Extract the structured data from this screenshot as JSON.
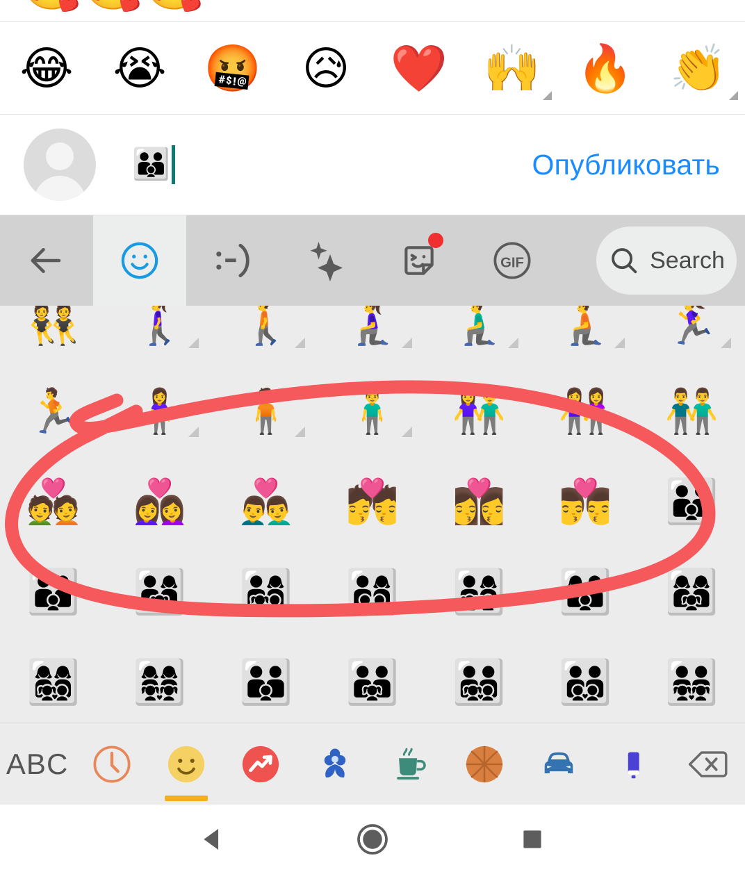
{
  "app": {
    "platform": "android",
    "locale": "ru",
    "background": "#ffffff",
    "keyboard_toolbar_bg": "#d2d2d2",
    "keyboard_panel_bg": "#ececec",
    "accent_link_color": "#1a8cff",
    "annotation_color": "#f5595c",
    "caret_color": "#0c7a72"
  },
  "partial_top_row": {
    "emojis": [
      "🥰",
      "🥰",
      "🥰"
    ]
  },
  "reaction_bar": {
    "items": [
      {
        "name": "reaction-face-with-tears-of-joy",
        "glyph": "😂",
        "has_variant_marker": false
      },
      {
        "name": "reaction-loudly-crying-face",
        "glyph": "😭",
        "has_variant_marker": false
      },
      {
        "name": "reaction-face-with-symbols-on-mouth",
        "glyph": "🤬",
        "has_variant_marker": false
      },
      {
        "name": "reaction-sad-but-relieved-face",
        "glyph": "😥",
        "has_variant_marker": false
      },
      {
        "name": "reaction-red-heart",
        "glyph": "❤️",
        "has_variant_marker": false
      },
      {
        "name": "reaction-raising-hands",
        "glyph": "🙌",
        "has_variant_marker": true
      },
      {
        "name": "reaction-fire",
        "glyph": "🔥",
        "has_variant_marker": false
      },
      {
        "name": "reaction-clapping-hands",
        "glyph": "👏",
        "has_variant_marker": true
      }
    ]
  },
  "composer": {
    "avatar_label": "default-avatar",
    "typed_text": "👨‍👨‍👦",
    "publish_label": "Опубликовать"
  },
  "keyboard_toolbar": {
    "tools": [
      {
        "name": "back-arrow-icon",
        "icon": "arrow-left",
        "active": false,
        "badge": false
      },
      {
        "name": "emoji-smiley-icon",
        "icon": "smiley",
        "active": true,
        "badge": false
      },
      {
        "name": "emoticon-ascii-icon",
        "icon": "emoticon-text",
        "active": false,
        "badge": false,
        "label": ":-)"
      },
      {
        "name": "sparkle-icon",
        "icon": "sparkles",
        "active": false,
        "badge": false
      },
      {
        "name": "sticker-icon",
        "icon": "sticker",
        "active": false,
        "badge": true
      },
      {
        "name": "gif-icon",
        "icon": "gif",
        "active": false,
        "badge": false,
        "label": "GIF"
      }
    ],
    "search": {
      "name": "search-button",
      "label": "Search",
      "icon": "search-icon"
    }
  },
  "emoji_grid": {
    "rows": [
      {
        "name": "emoji-row-people-activity",
        "cells": [
          {
            "glyph": "👯",
            "name": "people-with-bunny-ears",
            "variant": false
          },
          {
            "glyph": "🚶‍♀️",
            "name": "woman-walking",
            "variant": true
          },
          {
            "glyph": "🚶",
            "name": "person-walking",
            "variant": true
          },
          {
            "glyph": "🧎‍♀️",
            "name": "woman-kneeling",
            "variant": true
          },
          {
            "glyph": "🧎‍♂️",
            "name": "man-kneeling",
            "variant": true
          },
          {
            "glyph": "🧎",
            "name": "person-kneeling",
            "variant": true
          },
          {
            "glyph": "🏃‍♀️",
            "name": "woman-running",
            "variant": true
          }
        ]
      },
      {
        "name": "emoji-row-people-standing",
        "cells": [
          {
            "glyph": "🏃",
            "name": "person-running",
            "variant": true
          },
          {
            "glyph": "🧍‍♀️",
            "name": "woman-standing",
            "variant": true
          },
          {
            "glyph": "🧍",
            "name": "person-standing",
            "variant": true
          },
          {
            "glyph": "🧍‍♂️",
            "name": "man-standing",
            "variant": true
          },
          {
            "glyph": "👫",
            "name": "woman-and-man-holding-hands",
            "variant": false
          },
          {
            "glyph": "👭",
            "name": "women-holding-hands",
            "variant": false
          },
          {
            "glyph": "👬",
            "name": "men-holding-hands",
            "variant": false
          }
        ]
      },
      {
        "name": "emoji-row-couples-with-heart",
        "cells": [
          {
            "glyph": "💑",
            "name": "couple-with-heart",
            "variant": false
          },
          {
            "glyph": "👩‍❤️‍👩",
            "name": "couple-with-heart-woman-woman",
            "variant": false
          },
          {
            "glyph": "👨‍❤️‍👨",
            "name": "couple-with-heart-man-man",
            "variant": false
          },
          {
            "glyph": "💏",
            "name": "kiss",
            "variant": false
          },
          {
            "glyph": "👩‍❤️‍💋‍👩",
            "name": "kiss-woman-woman",
            "variant": false
          },
          {
            "glyph": "👨‍❤️‍💋‍👨",
            "name": "kiss-man-man",
            "variant": false
          },
          {
            "glyph": "👪",
            "name": "family",
            "variant": false
          }
        ]
      },
      {
        "name": "emoji-row-families-a",
        "cells": [
          {
            "glyph": "👨‍👩‍👦",
            "name": "family-man-woman-boy",
            "variant": false
          },
          {
            "glyph": "👨‍👩‍👧",
            "name": "family-man-woman-girl",
            "variant": false
          },
          {
            "glyph": "👨‍👩‍👧‍👦",
            "name": "family-man-woman-girl-boy",
            "variant": false
          },
          {
            "glyph": "👨‍👩‍👦‍👦",
            "name": "family-man-woman-boy-boy",
            "variant": false
          },
          {
            "glyph": "👨‍👩‍👧‍👧",
            "name": "family-man-woman-girl-girl",
            "variant": false
          },
          {
            "glyph": "👩‍👩‍👦",
            "name": "family-woman-woman-boy",
            "variant": false
          },
          {
            "glyph": "👩‍👩‍👧",
            "name": "family-woman-woman-girl",
            "variant": false
          }
        ]
      },
      {
        "name": "emoji-row-families-b",
        "cells": [
          {
            "glyph": "👩‍👩‍👧‍👦",
            "name": "family-woman-woman-girl-boy",
            "variant": false
          },
          {
            "glyph": "👩‍👩‍👧‍👧",
            "name": "family-woman-woman-girl-girl",
            "variant": false
          },
          {
            "glyph": "👨‍👨‍👦",
            "name": "family-man-man-boy",
            "variant": false
          },
          {
            "glyph": "👨‍👨‍👧",
            "name": "family-man-man-girl",
            "variant": false
          },
          {
            "glyph": "👨‍👨‍👧‍👦",
            "name": "family-man-man-girl-boy",
            "variant": false
          },
          {
            "glyph": "👨‍👨‍👦‍👦",
            "name": "family-man-man-boy-boy",
            "variant": false
          },
          {
            "glyph": "👨‍👨‍👧‍👧",
            "name": "family-man-man-girl-girl",
            "variant": false
          }
        ]
      }
    ]
  },
  "annotation": {
    "name": "red-circle-annotation",
    "shape": "hand-drawn-ellipse",
    "color": "#f5595c",
    "stroke_width": 19
  },
  "category_bar": {
    "items": [
      {
        "name": "abc-key",
        "type": "text",
        "label": "ABC",
        "selected": false
      },
      {
        "name": "recent-clock-icon",
        "type": "clock",
        "color": "#e8875a",
        "selected": false
      },
      {
        "name": "smileys-people-icon",
        "type": "smiley",
        "color": "#f5d063",
        "selected": true
      },
      {
        "name": "trending-icon",
        "type": "trending",
        "color": "#ef5350",
        "selected": false
      },
      {
        "name": "nature-flower-icon",
        "type": "flower",
        "color": "#2f62c4",
        "selected": false
      },
      {
        "name": "food-drink-icon",
        "type": "cup",
        "color": "#3d8b7a",
        "selected": false
      },
      {
        "name": "activity-basketball-icon",
        "type": "basketball",
        "color": "#d98040",
        "selected": false
      },
      {
        "name": "travel-car-icon",
        "type": "car",
        "color": "#3572b0",
        "selected": false
      },
      {
        "name": "objects-battery-icon",
        "type": "battery",
        "color": "#4b41d4",
        "selected": false
      },
      {
        "name": "backspace-icon",
        "type": "backspace",
        "color": "#6a6a6a",
        "selected": false
      }
    ],
    "selected_index": 2,
    "underline_color": "#f2b01e"
  },
  "nav_bar": {
    "items": [
      {
        "name": "nav-back-button",
        "shape": "triangle-left"
      },
      {
        "name": "nav-home-button",
        "shape": "circle"
      },
      {
        "name": "nav-recents-button",
        "shape": "square"
      }
    ]
  }
}
